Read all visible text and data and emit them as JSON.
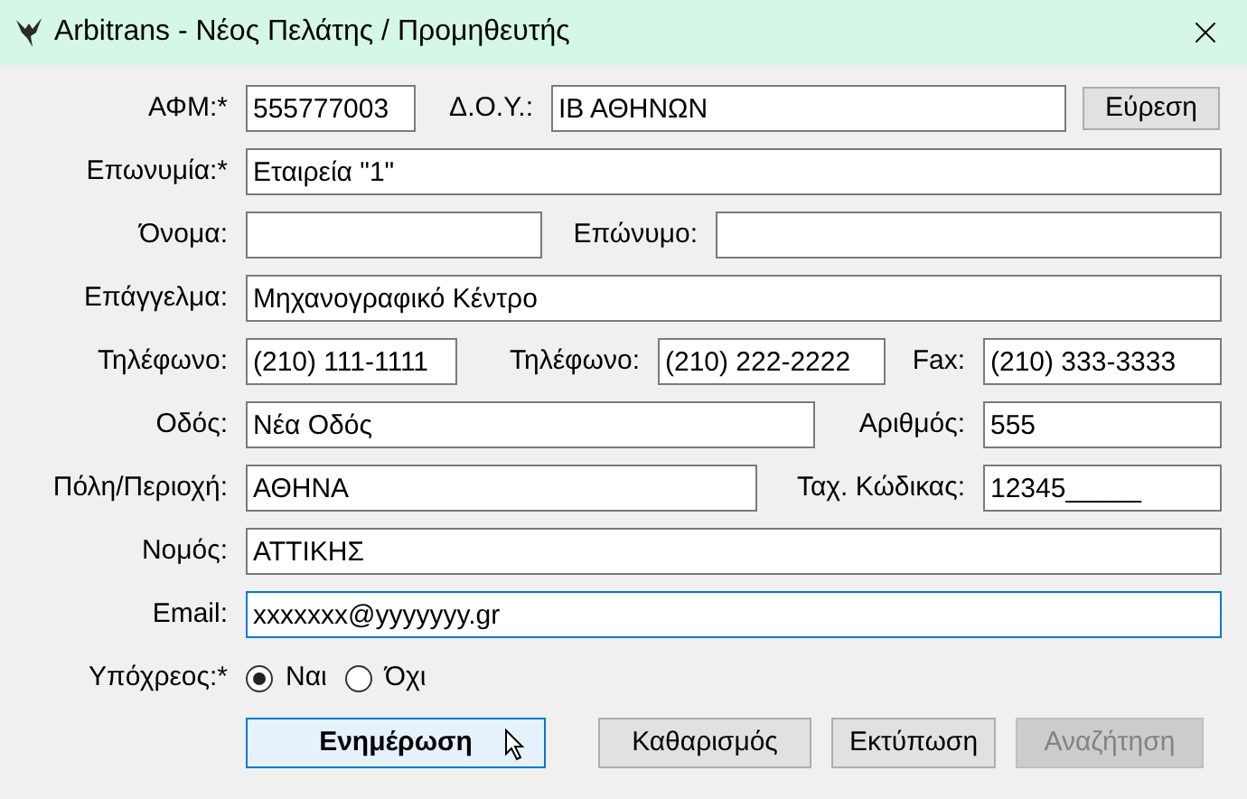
{
  "window": {
    "title": "Arbitrans - Νέος Πελάτης / Προμηθευτής"
  },
  "rows": [
    {
      "items": [
        {
          "kind": "label",
          "text": "ΑΦΜ:*"
        },
        {
          "kind": "field",
          "value": "555777003",
          "focused": false
        },
        {
          "kind": "label",
          "text": "Δ.Ο.Υ.:"
        },
        {
          "kind": "field",
          "value": "ΙΒ ΑΘΗΝΩΝ",
          "focused": false
        },
        {
          "kind": "button",
          "text": "Εύρεση"
        }
      ]
    },
    {
      "items": [
        {
          "kind": "label",
          "text": "Επωνυμία:*"
        },
        {
          "kind": "field",
          "value": "Εταιρεία \"1\"",
          "focused": false
        }
      ]
    },
    {
      "items": [
        {
          "kind": "label",
          "text": "Όνομα:"
        },
        {
          "kind": "field",
          "focused": false
        },
        {
          "kind": "label",
          "text": "Επώνυμο:"
        },
        {
          "kind": "field",
          "focused": false
        }
      ]
    },
    {
      "items": [
        {
          "kind": "label",
          "text": "Επάγγελμα:"
        },
        {
          "kind": "field",
          "value": "Μηχανογραφικό Κέντρο",
          "focused": false
        }
      ]
    },
    {
      "items": [
        {
          "kind": "label",
          "text": "Τηλέφωνο:"
        },
        {
          "kind": "field",
          "value": "(210) 111-1111",
          "focused": false
        },
        {
          "kind": "label",
          "text": "Τηλέφωνο:"
        },
        {
          "kind": "field",
          "value": "(210) 222-2222",
          "focused": false
        },
        {
          "kind": "label",
          "text": "Fax:"
        },
        {
          "kind": "field",
          "value": "(210) 333-3333",
          "focused": false
        }
      ]
    },
    {
      "items": [
        {
          "kind": "label",
          "text": "Οδός:"
        },
        {
          "kind": "field",
          "value": "Νέα Οδός",
          "focused": false
        },
        {
          "kind": "label",
          "text": "Αριθμός:"
        },
        {
          "kind": "field",
          "value": "555",
          "focused": false
        }
      ]
    },
    {
      "items": [
        {
          "kind": "label",
          "text": "Πόλη/Περιοχή:"
        },
        {
          "kind": "field",
          "value": "ΑΘΗΝΑ",
          "focused": false
        },
        {
          "kind": "label",
          "text": "Ταχ. Κώδικας:"
        },
        {
          "kind": "field",
          "value": "12345_____",
          "focused": false
        }
      ]
    },
    {
      "items": [
        {
          "kind": "label",
          "text": "Νομός:"
        },
        {
          "kind": "field",
          "value": "ΑΤΤΙΚΗΣ",
          "focused": false
        }
      ]
    },
    {
      "items": [
        {
          "kind": "label",
          "text": "Email:"
        },
        {
          "kind": "field",
          "value": "xxxxxxx@yyyyyyy.gr",
          "focused": true
        }
      ]
    }
  ],
  "obligated": {
    "label": "Υπόχρεος:*",
    "options": [
      {
        "text": "Ναι",
        "selected": true
      },
      {
        "text": "Όχι",
        "selected": false
      }
    ]
  },
  "buttons": [
    {
      "text": "Ενημέρωση",
      "default": true,
      "disabled": false
    },
    {
      "text": "Καθαρισμός",
      "default": false,
      "disabled": false
    },
    {
      "text": "Εκτύπωση",
      "default": false,
      "disabled": false
    },
    {
      "text": "Αναζήτηση",
      "default": false,
      "disabled": true
    }
  ]
}
